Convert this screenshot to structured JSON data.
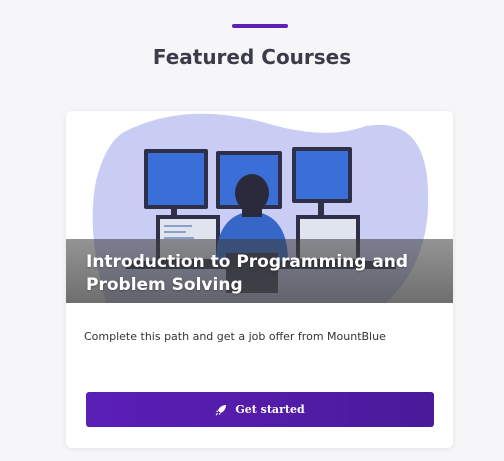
{
  "section": {
    "title": "Featured Courses",
    "accent_color": "#5b21b6"
  },
  "course_card": {
    "title": "Introduction to Programming and Problem Solving",
    "description": "Complete this path and get a job offer from MountBlue",
    "button_label": "Get started",
    "button_icon": "rocket-icon",
    "image_icon": "programmer-at-monitors-illustration",
    "button_color": "#5b1fb8"
  }
}
